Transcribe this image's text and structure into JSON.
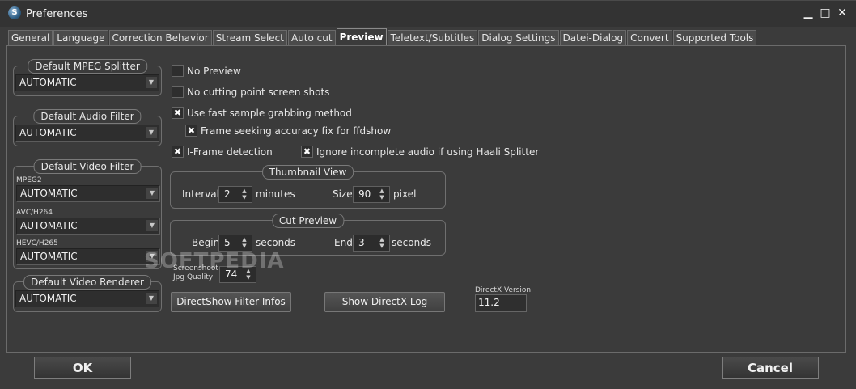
{
  "window": {
    "title": "Preferences"
  },
  "tabs": [
    {
      "label": "General"
    },
    {
      "label": "Language"
    },
    {
      "label": "Correction Behavior"
    },
    {
      "label": "Stream Select"
    },
    {
      "label": "Auto cut"
    },
    {
      "label": "Preview",
      "active": true
    },
    {
      "label": "Teletext/Subtitles"
    },
    {
      "label": "Dialog Settings"
    },
    {
      "label": "Datei-Dialog"
    },
    {
      "label": "Convert"
    },
    {
      "label": "Supported Tools"
    }
  ],
  "left": {
    "mpeg_splitter": {
      "title": "Default MPEG Splitter",
      "value": "AUTOMATIC"
    },
    "audio_filter": {
      "title": "Default Audio Filter",
      "value": "AUTOMATIC"
    },
    "video_filter": {
      "title": "Default Video Filter",
      "mpeg2_label": "MPEG2",
      "mpeg2_value": "AUTOMATIC",
      "avc_label": "AVC/H264",
      "avc_value": "AUTOMATIC",
      "hevc_label": "HEVC/H265",
      "hevc_value": "AUTOMATIC"
    },
    "video_renderer": {
      "title": "Default Video Renderer",
      "value": "AUTOMATIC"
    }
  },
  "options": {
    "no_preview": {
      "label": "No Preview",
      "checked": false
    },
    "no_cutting_shots": {
      "label": "No cutting point screen shots",
      "checked": false
    },
    "fast_grabbing": {
      "label": "Use fast sample grabbing method",
      "checked": true
    },
    "frame_seek_fix": {
      "label": "Frame seeking accuracy fix for ffdshow",
      "checked": true
    },
    "iframe_detection": {
      "label": "I-Frame detection",
      "checked": true
    },
    "ignore_audio": {
      "label": "Ignore incomplete audio if using Haali Splitter",
      "checked": true
    }
  },
  "thumbnail": {
    "title": "Thumbnail View",
    "interval_label": "Interval",
    "interval_value": "2",
    "interval_unit": "minutes",
    "size_label": "Size",
    "size_value": "90",
    "size_unit": "pixel"
  },
  "cut_preview": {
    "title": "Cut Preview",
    "begin_label": "Begin",
    "begin_value": "5",
    "begin_unit": "seconds",
    "end_label": "End",
    "end_value": "3",
    "end_unit": "seconds"
  },
  "screenshot": {
    "label_line1": "Screenshoot",
    "label_line2": "Jpg Quality",
    "value": "74"
  },
  "buttons": {
    "directshow": "DirectShow Filter Infos",
    "directx_log": "Show DirectX Log",
    "ok": "OK",
    "cancel": "Cancel"
  },
  "directx": {
    "label": "DirectX Version",
    "value": "11.2"
  },
  "watermark": "SOFTPEDIA",
  "colors": {
    "background": "#3b3b3b",
    "text": "#e8e8e8",
    "border": "#6f6f6f"
  }
}
